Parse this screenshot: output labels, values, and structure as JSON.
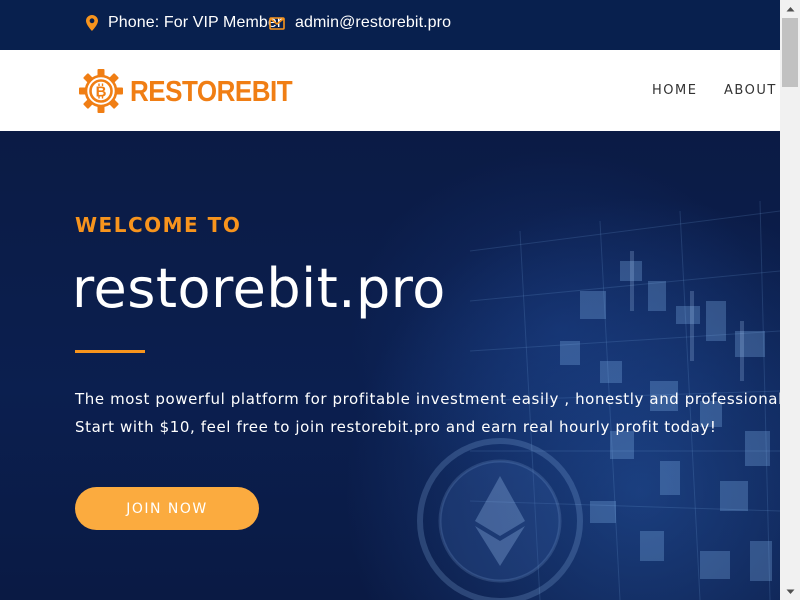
{
  "topbar": {
    "phone_icon": "map-marker-icon",
    "phone_text": "Phone: For VIP Member",
    "email_icon": "envelope-icon",
    "email_text": "admin@restorebit.pro"
  },
  "navbar": {
    "logo_icon": "bitcoin-gear-icon",
    "logo_text": "RESTOREBIT",
    "links": [
      "HOME",
      "ABOUT US"
    ]
  },
  "hero": {
    "welcome": "WELCOME TO",
    "title": "restorebit.pro",
    "description_line1": "The most powerful platform for profitable investment easily , honestly and professionally.",
    "description_line2": "Start with $10, feel free to join restorebit.pro and earn real hourly profit today!",
    "cta_label": "JOIN NOW"
  },
  "colors": {
    "topbar_bg": "#08204e",
    "accent_orange": "#f7941d",
    "logo_orange": "#f07e14",
    "button_orange": "#fbab3f",
    "hero_bg": "#0b1b45"
  }
}
